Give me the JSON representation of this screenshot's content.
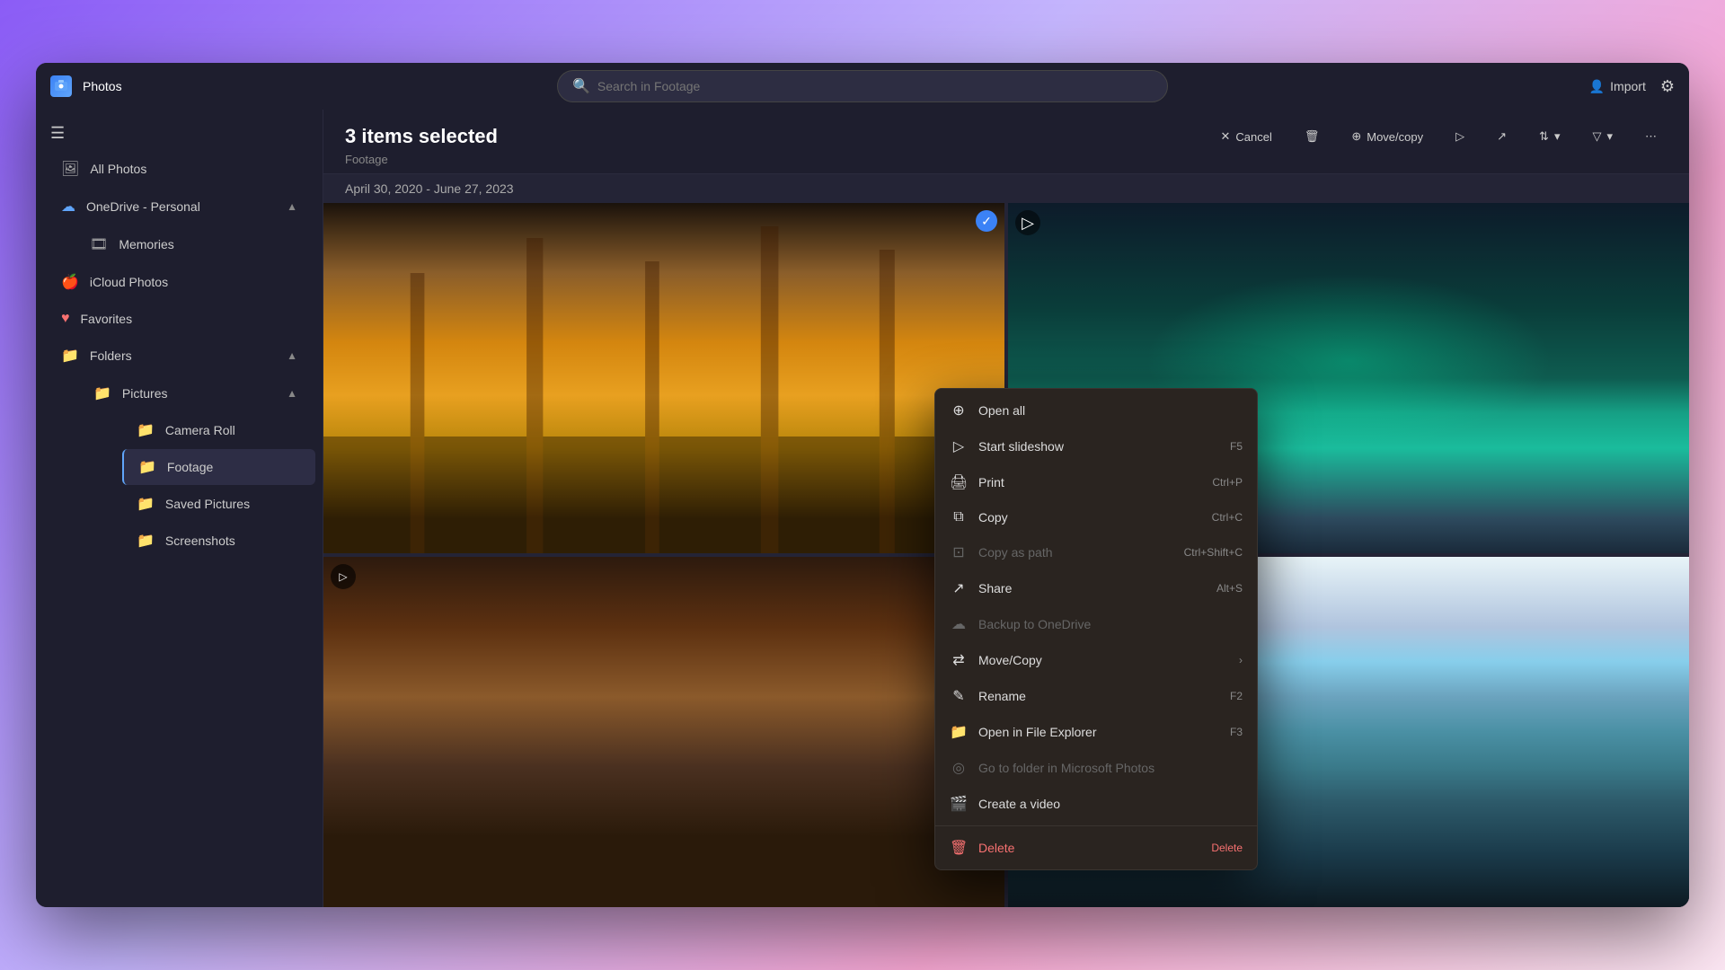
{
  "app": {
    "title": "Photos",
    "icon": "📷"
  },
  "search": {
    "placeholder": "Search in Footage"
  },
  "header": {
    "import_label": "Import",
    "import_icon": "person-icon",
    "settings_icon": "gear-icon"
  },
  "sidebar": {
    "menu_icon": "☰",
    "all_photos": "All Photos",
    "onedrive_section": "OneDrive - Personal",
    "memories": "Memories",
    "icloud": "iCloud Photos",
    "favorites": "Favorites",
    "folders": "Folders",
    "pictures": "Pictures",
    "camera_roll": "Camera Roll",
    "footage": "Footage",
    "saved_pictures": "Saved Pictures",
    "screenshots": "Screenshots"
  },
  "content": {
    "selection_title": "3 items selected",
    "subtitle": "Footage",
    "date_range": "April 30, 2020 - June 27, 2023",
    "cancel_label": "Cancel",
    "delete_icon": "🗑",
    "move_copy_label": "Move/copy"
  },
  "context_menu": {
    "items": [
      {
        "id": "open-all",
        "icon": "⊕",
        "label": "Open all",
        "shortcut": "",
        "disabled": false,
        "danger": false,
        "arrow": false
      },
      {
        "id": "start-slideshow",
        "icon": "▷",
        "label": "Start slideshow",
        "shortcut": "F5",
        "disabled": false,
        "danger": false,
        "arrow": false
      },
      {
        "id": "print",
        "icon": "🖨",
        "label": "Print",
        "shortcut": "Ctrl+P",
        "disabled": false,
        "danger": false,
        "arrow": false
      },
      {
        "id": "copy",
        "icon": "⧉",
        "label": "Copy",
        "shortcut": "Ctrl+C",
        "disabled": false,
        "danger": false,
        "arrow": false
      },
      {
        "id": "copy-as-path",
        "icon": "⊡",
        "label": "Copy as path",
        "shortcut": "Ctrl+Shift+C",
        "disabled": true,
        "danger": false,
        "arrow": false
      },
      {
        "id": "share",
        "icon": "↗",
        "label": "Share",
        "shortcut": "Alt+S",
        "disabled": false,
        "danger": false,
        "arrow": false
      },
      {
        "id": "backup-to-onedrive",
        "icon": "☁",
        "label": "Backup to OneDrive",
        "shortcut": "",
        "disabled": true,
        "danger": false,
        "arrow": false
      },
      {
        "id": "move-copy",
        "icon": "⇄",
        "label": "Move/Copy",
        "shortcut": "",
        "disabled": false,
        "danger": false,
        "arrow": true
      },
      {
        "id": "rename",
        "icon": "✎",
        "label": "Rename",
        "shortcut": "F2",
        "disabled": false,
        "danger": false,
        "arrow": false
      },
      {
        "id": "open-in-file-explorer",
        "icon": "📁",
        "label": "Open in File Explorer",
        "shortcut": "F3",
        "disabled": false,
        "danger": false,
        "arrow": false
      },
      {
        "id": "go-to-folder",
        "icon": "◎",
        "label": "Go to folder in Microsoft Photos",
        "shortcut": "",
        "disabled": true,
        "danger": false,
        "arrow": false
      },
      {
        "id": "create-a-video",
        "icon": "🎬",
        "label": "Create a video",
        "shortcut": "",
        "disabled": false,
        "danger": false,
        "arrow": false
      },
      {
        "id": "delete",
        "icon": "🗑",
        "label": "Delete",
        "shortcut": "Delete",
        "disabled": false,
        "danger": true,
        "arrow": false
      }
    ]
  },
  "photos": [
    {
      "id": "autumn-park",
      "type": "photo",
      "selected": true,
      "style": "autumn"
    },
    {
      "id": "aurora",
      "type": "video",
      "selected": false,
      "style": "aurora"
    },
    {
      "id": "aerial",
      "type": "video",
      "selected": false,
      "style": "aerial"
    },
    {
      "id": "mountain",
      "type": "photo",
      "selected": false,
      "style": "mountain"
    }
  ]
}
